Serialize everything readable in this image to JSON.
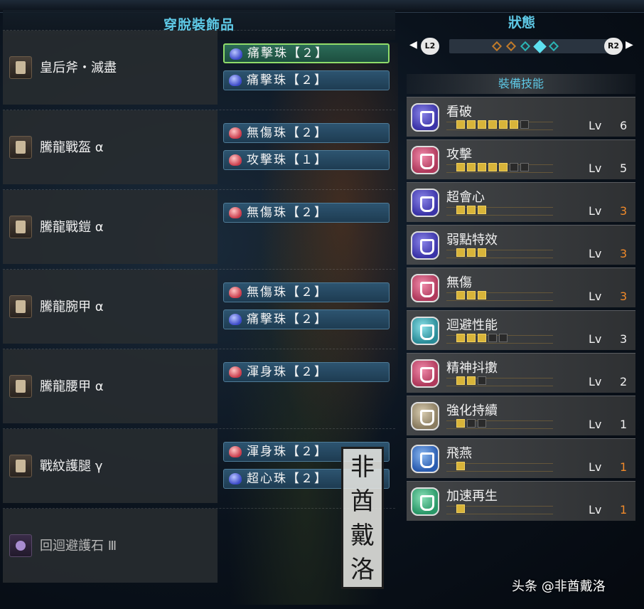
{
  "left_panel": {
    "title": "穿脫裝飾品",
    "items": [
      {
        "name": "皇后斧・滅盡",
        "icon": "weapon-icon",
        "decorations": [
          {
            "label": "痛擊珠【２】",
            "color": "blue",
            "selected": true
          },
          {
            "label": "痛擊珠【２】",
            "color": "blue",
            "selected": false
          }
        ]
      },
      {
        "name": "騰龍戰盔 α",
        "icon": "helm-icon",
        "decorations": [
          {
            "label": "無傷珠【２】",
            "color": "red",
            "selected": false
          },
          {
            "label": "攻擊珠【１】",
            "color": "red",
            "selected": false
          }
        ]
      },
      {
        "name": "騰龍戰鎧 α",
        "icon": "chest-icon",
        "decorations": [
          {
            "label": "無傷珠【２】",
            "color": "red",
            "selected": false
          }
        ]
      },
      {
        "name": "騰龍腕甲 α",
        "icon": "arms-icon",
        "decorations": [
          {
            "label": "無傷珠【２】",
            "color": "red",
            "selected": false
          },
          {
            "label": "痛擊珠【２】",
            "color": "blue",
            "selected": false
          }
        ]
      },
      {
        "name": "騰龍腰甲 α",
        "icon": "waist-icon",
        "decorations": [
          {
            "label": "渾身珠【２】",
            "color": "red",
            "selected": false
          }
        ]
      },
      {
        "name": "戰紋護腿 γ",
        "icon": "legs-icon",
        "decorations": [
          {
            "label": "渾身珠【２】",
            "color": "red",
            "selected": false
          },
          {
            "label": "超心珠【２】",
            "color": "blue",
            "selected": false
          }
        ]
      },
      {
        "name": "回迴避護石 Ⅲ",
        "icon": "charm-icon",
        "decorations": []
      }
    ]
  },
  "right_panel": {
    "title": "狀態",
    "left_button": "L2",
    "right_button": "R2",
    "left_arrow": "◀",
    "right_arrow": "▶",
    "section_title": "裝備技能",
    "lv_label": "Lv",
    "skills": [
      {
        "name": "看破",
        "level": 6,
        "max": 7,
        "icon_color": "purple",
        "maxed": false
      },
      {
        "name": "攻擊",
        "level": 5,
        "max": 7,
        "icon_color": "pink",
        "maxed": false
      },
      {
        "name": "超會心",
        "level": 3,
        "max": 3,
        "icon_color": "purple",
        "maxed": true
      },
      {
        "name": "弱點特效",
        "level": 3,
        "max": 3,
        "icon_color": "purple",
        "maxed": true
      },
      {
        "name": "無傷",
        "level": 3,
        "max": 3,
        "icon_color": "pink",
        "maxed": true
      },
      {
        "name": "迴避性能",
        "level": 3,
        "max": 5,
        "icon_color": "cyan",
        "maxed": false
      },
      {
        "name": "精神抖擻",
        "level": 2,
        "max": 3,
        "icon_color": "pink",
        "maxed": false
      },
      {
        "name": "強化持續",
        "level": 1,
        "max": 3,
        "icon_color": "beige",
        "maxed": false
      },
      {
        "name": "飛燕",
        "level": 1,
        "max": 1,
        "icon_color": "blue",
        "maxed": true
      },
      {
        "name": "加速再生",
        "level": 1,
        "max": 1,
        "icon_color": "green",
        "maxed": true
      }
    ]
  },
  "watermark": {
    "chars": [
      "非",
      "酋",
      "戴",
      "洛"
    ]
  },
  "credit": "头条 @非酋戴洛",
  "colors": {
    "accent": "#5ec9e6",
    "max_level": "#f08a2a",
    "pip_on": "#d8b43a",
    "selected_border": "#8fdc6a"
  }
}
